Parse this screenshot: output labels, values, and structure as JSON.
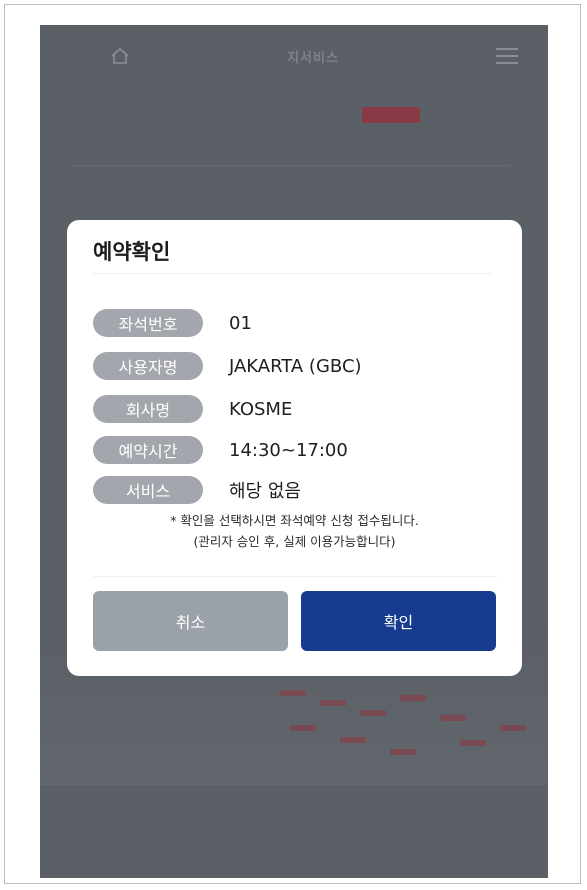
{
  "app": {
    "brand": "지서비스"
  },
  "modal": {
    "title": "예약확인",
    "rows": [
      {
        "label": "좌석번호",
        "value": "01"
      },
      {
        "label": "사용자명",
        "value": "JAKARTA (GBC)"
      },
      {
        "label": "회사명",
        "value": "KOSME"
      },
      {
        "label": "예약시간",
        "value": "14:30~17:00"
      },
      {
        "label": "서비스",
        "value": "해당 없음"
      }
    ],
    "note_line1": "* 확인을 선택하시면 좌석예약 신청 접수됩니다.",
    "note_line2": "(관리자 승인 후, 실제 이용가능합니다)",
    "cancel_label": "취소",
    "confirm_label": "확인"
  },
  "colors": {
    "overlay": "#5b5f66",
    "badge": "#a3a7ad",
    "confirm": "#173c8f",
    "cancel": "#9ba1a9"
  },
  "icons": [
    "home-icon",
    "menu-icon"
  ]
}
